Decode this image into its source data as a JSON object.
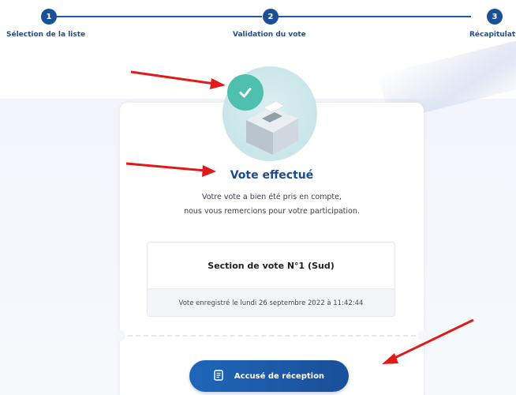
{
  "stepper": {
    "steps": [
      {
        "number": "1",
        "label": "Sélection de la liste"
      },
      {
        "number": "2",
        "label": "Validation du vote"
      },
      {
        "number": "3",
        "label": "Récapitulat"
      }
    ]
  },
  "confirmation": {
    "title": "Vote effectué",
    "line1": "Votre vote a bien été pris en compte,",
    "line2": "nous vous remercions pour votre participation."
  },
  "section": {
    "name": "Section de vote N°1 (Sud)",
    "recorded": "Vote enregistré le lundi 26 septembre 2022 à 11:42:44"
  },
  "receipt_button": {
    "label": "Accusé de réception",
    "icon": "receipt-icon"
  },
  "colors": {
    "primary": "#1b4f96",
    "success": "#4fbfae",
    "annotation_arrow": "#e01a1a"
  }
}
